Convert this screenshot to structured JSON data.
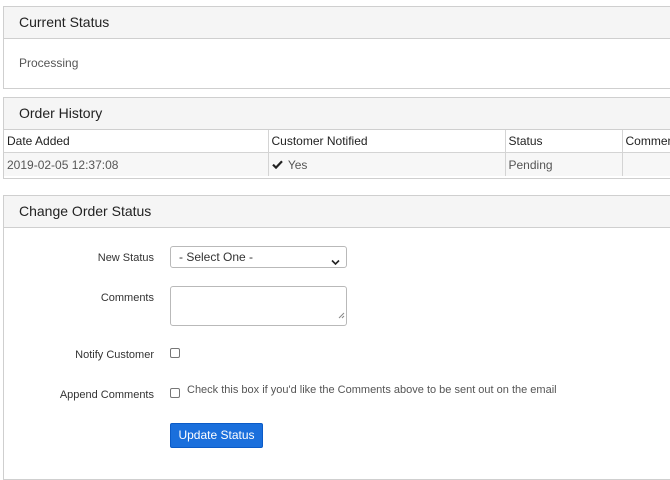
{
  "current_status": {
    "heading": "Current Status",
    "value": "Processing"
  },
  "order_history": {
    "heading": "Order History",
    "columns": [
      "Date Added",
      "Customer Notified",
      "Status",
      "Comments"
    ],
    "rows": [
      {
        "date_added": "2019-02-05 12:37:08",
        "customer_notified": "Yes",
        "customer_notified_icon": "check-icon",
        "status": "Pending",
        "comments": ""
      }
    ]
  },
  "change_order_status": {
    "heading": "Change Order Status",
    "new_status_label": "New Status",
    "new_status_selected": "- Select One -",
    "comments_label": "Comments",
    "comments_value": "",
    "notify_customer_label": "Notify Customer",
    "notify_customer_checked": false,
    "append_comments_label": "Append Comments",
    "append_comments_checked": false,
    "append_comments_hint": "Check this box if you'd like the Comments above to be sent out on the email",
    "submit_label": "Update Status"
  },
  "colors": {
    "panel_header_bg": "#f5f5f5",
    "border": "#cfcfcf",
    "row_bg": "#f7f7f7",
    "button_bg": "#1a6fdc"
  }
}
